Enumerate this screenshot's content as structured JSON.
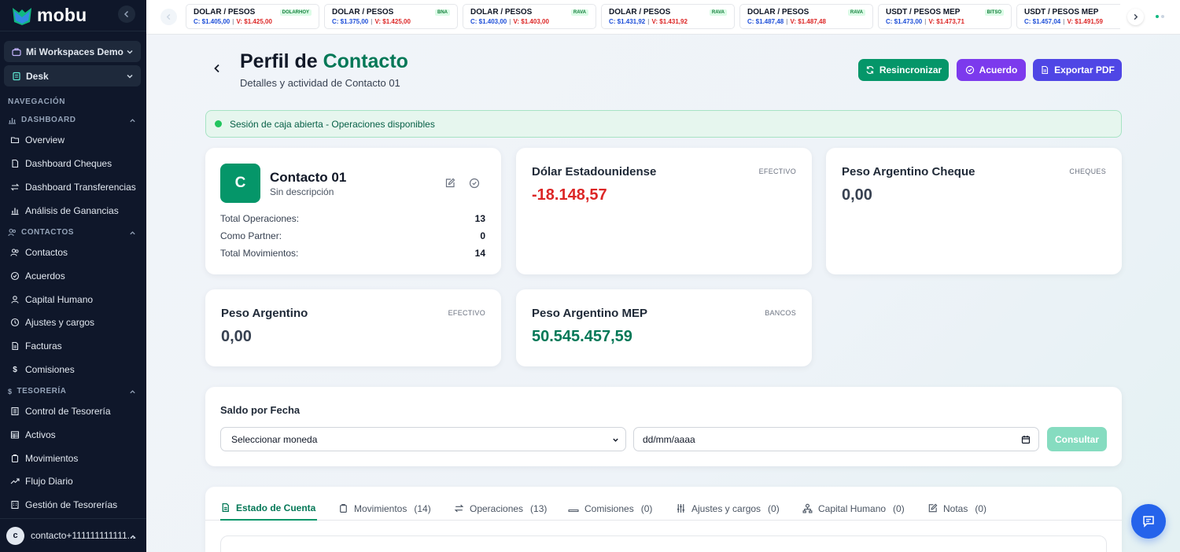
{
  "app": {
    "name": "mobu"
  },
  "sidebar": {
    "workspace": "Mi Workspaces Demo",
    "desk": "Desk",
    "nav_heading": "NAVEGACIÓN",
    "sections": {
      "dashboard": {
        "label": "DASHBOARD",
        "items": [
          "Overview",
          "Dashboard Cheques",
          "Dashboard Transferencias",
          "Análisis de Ganancias"
        ]
      },
      "contactos": {
        "label": "CONTACTOS",
        "items": [
          "Contactos",
          "Acuerdos",
          "Capital Humano",
          "Ajustes y cargos",
          "Facturas",
          "Comisiones"
        ]
      },
      "tesoreria": {
        "label": "TESORERÍA",
        "items": [
          "Control de Tesorería",
          "Activos",
          "Movimientos",
          "Flujo Diario",
          "Gestión de Tesorerías"
        ]
      }
    },
    "user": {
      "initial": "c",
      "email": "contacto+111111111111..."
    }
  },
  "ticker": [
    {
      "title": "DOLAR / PESOS",
      "source": "DOLARHOY",
      "compra": "C: $1.405,00",
      "venta": "V: $1.425,00"
    },
    {
      "title": "DOLAR / PESOS",
      "source": "BNA",
      "compra": "C: $1.375,00",
      "venta": "V: $1.425,00"
    },
    {
      "title": "DOLAR / PESOS",
      "source": "RAVA",
      "compra": "C: $1.403,00",
      "venta": "V: $1.403,00"
    },
    {
      "title": "DOLAR / PESOS",
      "source": "RAVA",
      "compra": "C: $1.431,92",
      "venta": "V: $1.431,92"
    },
    {
      "title": "DOLAR / PESOS",
      "source": "RAVA",
      "compra": "C: $1.487,48",
      "venta": "V: $1.487,48"
    },
    {
      "title": "USDT / PESOS MEP",
      "source": "BITSO",
      "compra": "C: $1.473,00",
      "venta": "V: $1.473,71"
    },
    {
      "title": "USDT / PESOS MEP",
      "source": "",
      "compra": "C: $1.457,04",
      "venta": "V: $1.491,59"
    }
  ],
  "header": {
    "title_part1": "Perfil de",
    "title_part2": "Contacto",
    "subtitle": "Detalles y actividad de Contacto 01",
    "buttons": {
      "resync": "Resincronizar",
      "agreement": "Acuerdo",
      "export": "Exportar PDF"
    },
    "colors": {
      "resync": "#059669",
      "agreement": "#7c3aed",
      "export": "#4f46e5"
    }
  },
  "alert": {
    "text": "Sesión de caja abierta - Operaciones disponibles"
  },
  "contact": {
    "initial": "C",
    "name": "Contacto 01",
    "description": "Sin descripción",
    "stats": [
      {
        "label": "Total Operaciones:",
        "value": "13"
      },
      {
        "label": "Como Partner:",
        "value": "0"
      },
      {
        "label": "Total Movimientos:",
        "value": "14"
      }
    ]
  },
  "balances": [
    {
      "name": "Dólar Estadounidense",
      "tag": "EFECTIVO",
      "value": "-18.148,57",
      "color": "#dc2626"
    },
    {
      "name": "Peso Argentino Cheque",
      "tag": "CHEQUES",
      "value": "0,00",
      "color": "#374151"
    },
    {
      "name": "Peso Argentino",
      "tag": "EFECTIVO",
      "value": "0,00",
      "color": "#374151"
    },
    {
      "name": "Peso Argentino MEP",
      "tag": "BANCOS",
      "value": "50.545.457,59",
      "color": "#047857"
    }
  ],
  "saldo": {
    "title": "Saldo por Fecha",
    "select_placeholder": "Seleccionar moneda",
    "date_placeholder": "dd/mm/aaaa",
    "button": "Consultar"
  },
  "tabs": [
    {
      "label": "Estado de Cuenta",
      "count": ""
    },
    {
      "label": "Movimientos",
      "count": "(14)"
    },
    {
      "label": "Operaciones",
      "count": "(13)"
    },
    {
      "label": "Comisiones",
      "count": "(0)"
    },
    {
      "label": "Ajustes y cargos",
      "count": "(0)"
    },
    {
      "label": "Capital Humano",
      "count": "(0)"
    },
    {
      "label": "Notas",
      "count": "(0)"
    }
  ]
}
